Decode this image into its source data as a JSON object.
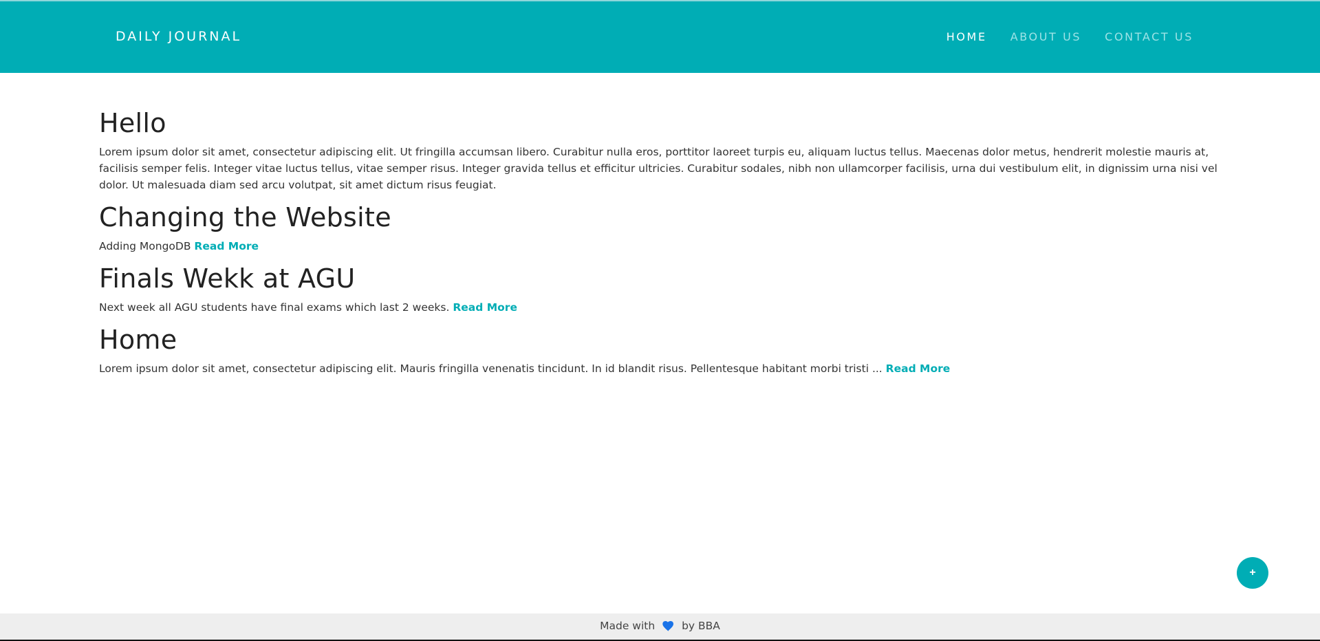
{
  "navbar": {
    "brand": "DAILY JOURNAL",
    "links": [
      {
        "label": "HOME",
        "active": true
      },
      {
        "label": "ABOUT US",
        "active": false
      },
      {
        "label": "CONTACT US",
        "active": false
      }
    ],
    "color": "#00adb5"
  },
  "posts": [
    {
      "title": "Hello",
      "body": "Lorem ipsum dolor sit amet, consectetur adipiscing elit. Ut fringilla accumsan libero. Curabitur nulla eros, porttitor laoreet turpis eu, aliquam luctus tellus. Maecenas dolor metus, hendrerit molestie mauris at, facilisis semper felis. Integer vitae luctus tellus, vitae semper risus. Integer gravida tellus et efficitur ultricies. Curabitur sodales, nibh non ullamcorper facilisis, urna dui vestibulum elit, in dignissim urna nisi vel dolor. Ut malesuada diam sed arcu volutpat, sit amet dictum risus feugiat.",
      "read_more": ""
    },
    {
      "title": "Changing the Website",
      "body": "Adding MongoDB ",
      "read_more": "Read More"
    },
    {
      "title": "Finals Wekk at AGU",
      "body": "Next week all AGU students have final exams which last 2 weeks. ",
      "read_more": "Read More"
    },
    {
      "title": "Home",
      "body": "Lorem ipsum dolor sit amet, consectetur adipiscing elit. Mauris fringilla venenatis tincidunt. In id blandit risus. Pellentesque habitant morbi tristi ... ",
      "read_more": "Read More"
    }
  ],
  "fab": {
    "label": "+",
    "icon": "plus-icon"
  },
  "footer": {
    "prefix": "Made with",
    "icon": "heart-icon",
    "suffix": "by BBA",
    "heart_color": "#1a73e8"
  }
}
